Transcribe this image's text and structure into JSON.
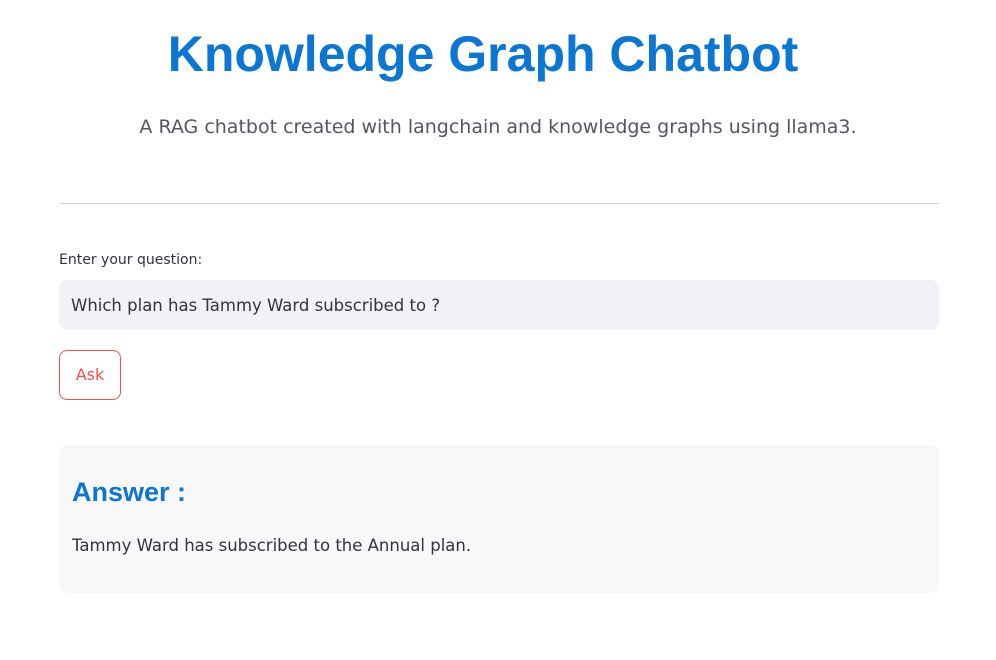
{
  "header": {
    "title": "Knowledge Graph Chatbot",
    "subtitle": "A RAG chatbot created with langchain and knowledge graphs using llama3."
  },
  "question": {
    "label": "Enter your question:",
    "value": "Which plan has Tammy Ward subscribed to ?"
  },
  "ask_button": {
    "label": "Ask"
  },
  "answer": {
    "heading": "Answer :",
    "text": "Tammy Ward has subscribed to the Annual plan."
  },
  "colors": {
    "accent": "#0b76d3",
    "button": "#ff4b4b",
    "input_bg": "#f0f2f6",
    "card_bg": "#f8f8f9"
  }
}
